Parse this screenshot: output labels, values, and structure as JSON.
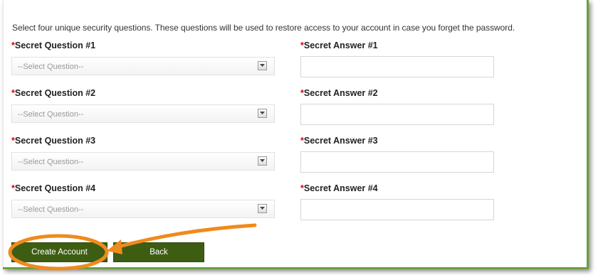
{
  "instructions": "Select four unique security questions. These questions will be used to restore access to your account in case you forget the password.",
  "required_mark": "*",
  "questions": [
    {
      "question_label": "Secret Question #1",
      "answer_label": "Secret Answer #1",
      "select_value": "--Select Question--",
      "answer_value": ""
    },
    {
      "question_label": "Secret Question #2",
      "answer_label": "Secret Answer #2",
      "select_value": "--Select Question--",
      "answer_value": ""
    },
    {
      "question_label": "Secret Question #3",
      "answer_label": "Secret Answer #3",
      "select_value": "--Select Question--",
      "answer_value": ""
    },
    {
      "question_label": "Secret Question #4",
      "answer_label": "Secret Answer #4",
      "select_value": "--Select Question--",
      "answer_value": ""
    }
  ],
  "buttons": {
    "create": "Create Account",
    "back": "Back"
  },
  "colors": {
    "button_bg": "#3d5e12",
    "annotation": "#f08a1c",
    "border_accent": "#6a9e3f",
    "required": "#d0021b"
  }
}
